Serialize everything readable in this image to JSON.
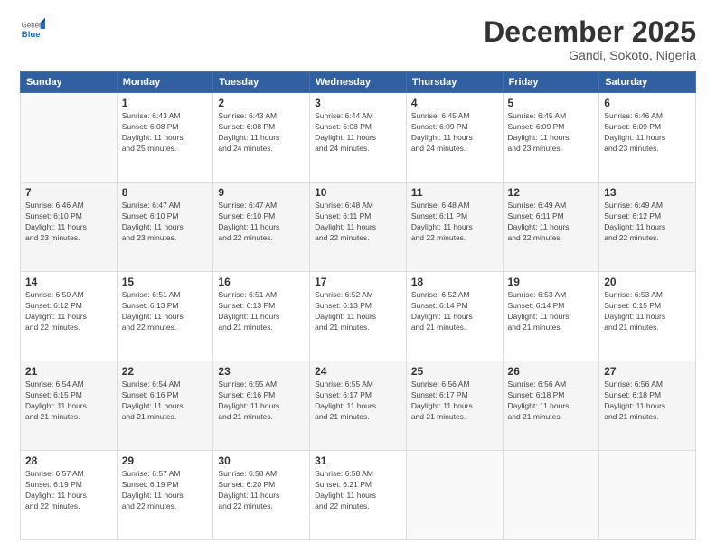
{
  "logo": {
    "general": "General",
    "blue": "Blue"
  },
  "header": {
    "month_year": "December 2025",
    "location": "Gandi, Sokoto, Nigeria"
  },
  "weekdays": [
    "Sunday",
    "Monday",
    "Tuesday",
    "Wednesday",
    "Thursday",
    "Friday",
    "Saturday"
  ],
  "weeks": [
    [
      {
        "day": "",
        "info": ""
      },
      {
        "day": "1",
        "info": "Sunrise: 6:43 AM\nSunset: 6:08 PM\nDaylight: 11 hours\nand 25 minutes."
      },
      {
        "day": "2",
        "info": "Sunrise: 6:43 AM\nSunset: 6:08 PM\nDaylight: 11 hours\nand 24 minutes."
      },
      {
        "day": "3",
        "info": "Sunrise: 6:44 AM\nSunset: 6:08 PM\nDaylight: 11 hours\nand 24 minutes."
      },
      {
        "day": "4",
        "info": "Sunrise: 6:45 AM\nSunset: 6:09 PM\nDaylight: 11 hours\nand 24 minutes."
      },
      {
        "day": "5",
        "info": "Sunrise: 6:45 AM\nSunset: 6:09 PM\nDaylight: 11 hours\nand 23 minutes."
      },
      {
        "day": "6",
        "info": "Sunrise: 6:46 AM\nSunset: 6:09 PM\nDaylight: 11 hours\nand 23 minutes."
      }
    ],
    [
      {
        "day": "7",
        "info": "Sunrise: 6:46 AM\nSunset: 6:10 PM\nDaylight: 11 hours\nand 23 minutes."
      },
      {
        "day": "8",
        "info": "Sunrise: 6:47 AM\nSunset: 6:10 PM\nDaylight: 11 hours\nand 23 minutes."
      },
      {
        "day": "9",
        "info": "Sunrise: 6:47 AM\nSunset: 6:10 PM\nDaylight: 11 hours\nand 22 minutes."
      },
      {
        "day": "10",
        "info": "Sunrise: 6:48 AM\nSunset: 6:11 PM\nDaylight: 11 hours\nand 22 minutes."
      },
      {
        "day": "11",
        "info": "Sunrise: 6:48 AM\nSunset: 6:11 PM\nDaylight: 11 hours\nand 22 minutes."
      },
      {
        "day": "12",
        "info": "Sunrise: 6:49 AM\nSunset: 6:11 PM\nDaylight: 11 hours\nand 22 minutes."
      },
      {
        "day": "13",
        "info": "Sunrise: 6:49 AM\nSunset: 6:12 PM\nDaylight: 11 hours\nand 22 minutes."
      }
    ],
    [
      {
        "day": "14",
        "info": "Sunrise: 6:50 AM\nSunset: 6:12 PM\nDaylight: 11 hours\nand 22 minutes."
      },
      {
        "day": "15",
        "info": "Sunrise: 6:51 AM\nSunset: 6:13 PM\nDaylight: 11 hours\nand 22 minutes."
      },
      {
        "day": "16",
        "info": "Sunrise: 6:51 AM\nSunset: 6:13 PM\nDaylight: 11 hours\nand 21 minutes."
      },
      {
        "day": "17",
        "info": "Sunrise: 6:52 AM\nSunset: 6:13 PM\nDaylight: 11 hours\nand 21 minutes."
      },
      {
        "day": "18",
        "info": "Sunrise: 6:52 AM\nSunset: 6:14 PM\nDaylight: 11 hours\nand 21 minutes."
      },
      {
        "day": "19",
        "info": "Sunrise: 6:53 AM\nSunset: 6:14 PM\nDaylight: 11 hours\nand 21 minutes."
      },
      {
        "day": "20",
        "info": "Sunrise: 6:53 AM\nSunset: 6:15 PM\nDaylight: 11 hours\nand 21 minutes."
      }
    ],
    [
      {
        "day": "21",
        "info": "Sunrise: 6:54 AM\nSunset: 6:15 PM\nDaylight: 11 hours\nand 21 minutes."
      },
      {
        "day": "22",
        "info": "Sunrise: 6:54 AM\nSunset: 6:16 PM\nDaylight: 11 hours\nand 21 minutes."
      },
      {
        "day": "23",
        "info": "Sunrise: 6:55 AM\nSunset: 6:16 PM\nDaylight: 11 hours\nand 21 minutes."
      },
      {
        "day": "24",
        "info": "Sunrise: 6:55 AM\nSunset: 6:17 PM\nDaylight: 11 hours\nand 21 minutes."
      },
      {
        "day": "25",
        "info": "Sunrise: 6:56 AM\nSunset: 6:17 PM\nDaylight: 11 hours\nand 21 minutes."
      },
      {
        "day": "26",
        "info": "Sunrise: 6:56 AM\nSunset: 6:18 PM\nDaylight: 11 hours\nand 21 minutes."
      },
      {
        "day": "27",
        "info": "Sunrise: 6:56 AM\nSunset: 6:18 PM\nDaylight: 11 hours\nand 21 minutes."
      }
    ],
    [
      {
        "day": "28",
        "info": "Sunrise: 6:57 AM\nSunset: 6:19 PM\nDaylight: 11 hours\nand 22 minutes."
      },
      {
        "day": "29",
        "info": "Sunrise: 6:57 AM\nSunset: 6:19 PM\nDaylight: 11 hours\nand 22 minutes."
      },
      {
        "day": "30",
        "info": "Sunrise: 6:58 AM\nSunset: 6:20 PM\nDaylight: 11 hours\nand 22 minutes."
      },
      {
        "day": "31",
        "info": "Sunrise: 6:58 AM\nSunset: 6:21 PM\nDaylight: 11 hours\nand 22 minutes."
      },
      {
        "day": "",
        "info": ""
      },
      {
        "day": "",
        "info": ""
      },
      {
        "day": "",
        "info": ""
      }
    ]
  ]
}
